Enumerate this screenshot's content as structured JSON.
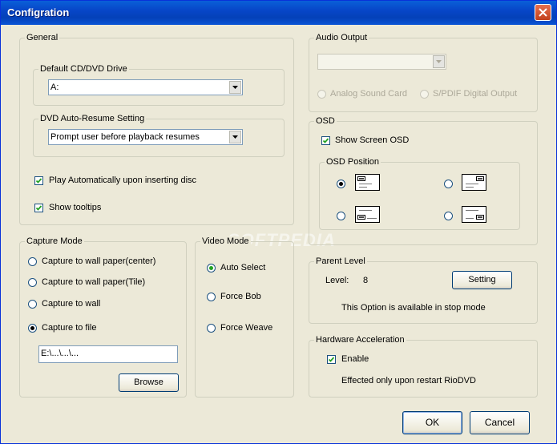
{
  "window": {
    "title": "Configration"
  },
  "general": {
    "title": "General",
    "default_drive": {
      "label": "Default CD/DVD Drive",
      "value": "A:"
    },
    "auto_resume": {
      "label": "DVD Auto-Resume Setting",
      "value": "Prompt user before playback resumes"
    },
    "play_auto": {
      "label": "Play Automatically upon inserting disc",
      "checked": true
    },
    "show_tooltips": {
      "label": "Show tooltips",
      "checked": true
    }
  },
  "capture": {
    "title": "Capture Mode",
    "options": [
      {
        "label": "Capture to wall paper(center)",
        "selected": false
      },
      {
        "label": "Capture to wall paper(Tile)",
        "selected": false
      },
      {
        "label": "Capture to wall",
        "selected": false
      },
      {
        "label": "Capture to file",
        "selected": true
      }
    ],
    "path": "E:\\...\\...\\...",
    "browse_label": "Browse"
  },
  "video_mode": {
    "title": "Video Mode",
    "options": [
      {
        "label": "Auto Select",
        "selected": true
      },
      {
        "label": "Force Bob",
        "selected": false
      },
      {
        "label": "Force Weave",
        "selected": false
      }
    ]
  },
  "audio": {
    "title": "Audio Output",
    "analog_label": "Analog Sound Card",
    "spdif_label": "S/PDIF Digital Output"
  },
  "osd": {
    "title": "OSD",
    "show_label": "Show Screen OSD",
    "show_checked": true,
    "position_title": "OSD Position",
    "selected_position": "top-left"
  },
  "parent": {
    "title": "Parent Level",
    "level_label": "Level:",
    "level_value": "8",
    "setting_label": "Setting",
    "note": "This Option is available in stop mode"
  },
  "hardware": {
    "title": "Hardware Acceleration",
    "enable_label": "Enable",
    "enable_checked": true,
    "note": "Effected only upon restart RioDVD"
  },
  "footer": {
    "ok_label": "OK",
    "cancel_label": "Cancel"
  },
  "watermark": "SOFTPEDIA"
}
